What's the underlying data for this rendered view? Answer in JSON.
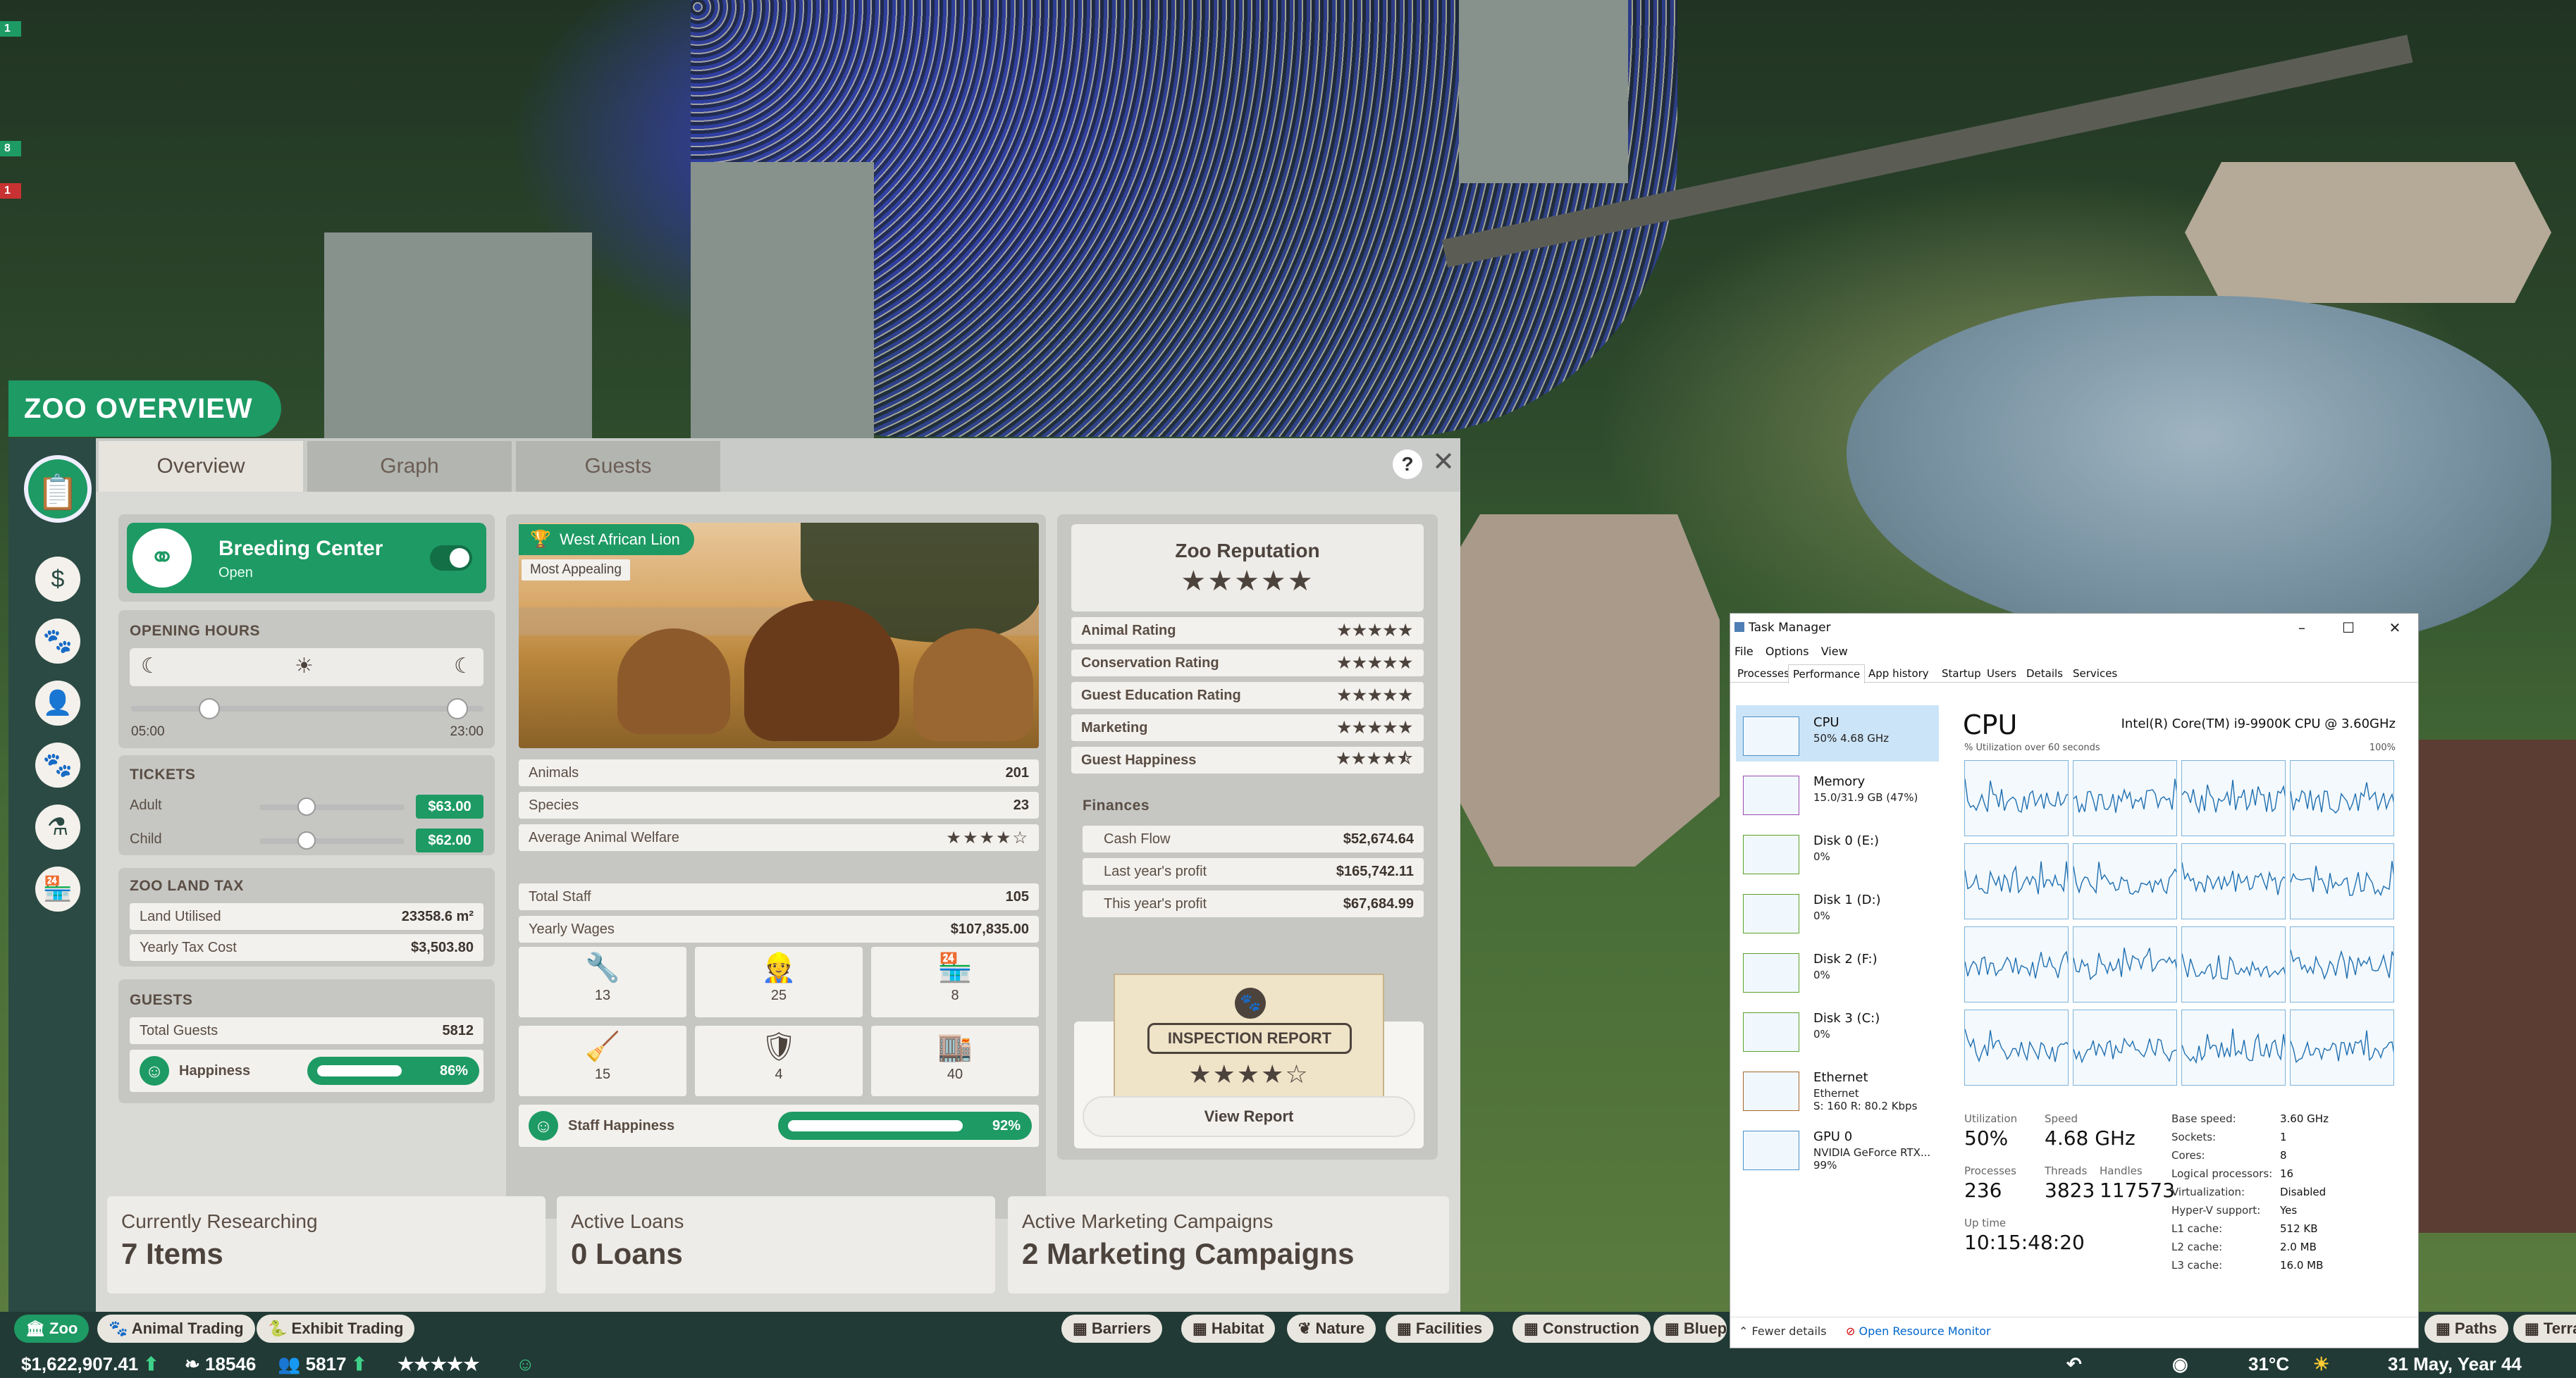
{
  "game": {
    "side_flags": [
      {
        "label": "1",
        "color": "#1e9a64"
      },
      {
        "label": "8",
        "color": "#1e9a64"
      },
      {
        "label": "1",
        "color": "#c83232"
      }
    ],
    "panel_title": "ZOO OVERVIEW",
    "tabs": [
      "Overview",
      "Graph",
      "Guests"
    ],
    "help_label": "?",
    "close_label": "✕",
    "breeding": {
      "title": "Breeding Center",
      "status": "Open"
    },
    "opening_hours": {
      "title": "OPENING HOURS",
      "open": "05:00",
      "close": "23:00"
    },
    "tickets": {
      "title": "TICKETS",
      "adult_label": "Adult",
      "adult_price": "$63.00",
      "child_label": "Child",
      "child_price": "$62.00"
    },
    "land_tax": {
      "title": "ZOO LAND TAX",
      "land_label": "Land Utilised",
      "land_value": "23358.6 m²",
      "tax_label": "Yearly Tax Cost",
      "tax_value": "$3,503.80"
    },
    "guests": {
      "title": "GUESTS",
      "total_label": "Total Guests",
      "total_value": "5812",
      "happiness_label": "Happiness",
      "happiness_pct": "86%",
      "happiness_level": 0.86
    },
    "featured": {
      "badge": "West African Lion",
      "sub": "Most Appealing"
    },
    "animals": [
      {
        "label": "Animals",
        "value": "201"
      },
      {
        "label": "Species",
        "value": "23"
      }
    ],
    "welfare_label": "Average Animal Welfare",
    "welfare_stars": 4,
    "staff": {
      "total_label": "Total Staff",
      "total_value": "105",
      "wages_label": "Yearly Wages",
      "wages_value": "$107,835.00",
      "counts": [
        {
          "icon": "wrench-icon",
          "glyph": "🔧",
          "value": "13"
        },
        {
          "icon": "zookeeper-icon",
          "glyph": "👷",
          "value": "25"
        },
        {
          "icon": "vendor-icon",
          "glyph": "🏪",
          "value": "8"
        },
        {
          "icon": "broom-icon",
          "glyph": "🧹",
          "value": "15"
        },
        {
          "icon": "security-icon",
          "glyph": "🛡",
          "value": "4"
        },
        {
          "icon": "shop-icon",
          "glyph": "🏬",
          "value": "40"
        }
      ],
      "happiness_label": "Staff Happiness",
      "happiness_pct": "92%",
      "happiness_level": 0.92
    },
    "reputation": {
      "title": "Zoo Reputation",
      "stars": 5,
      "ratings": [
        {
          "label": "Animal Rating",
          "stars": 5
        },
        {
          "label": "Conservation Rating",
          "stars": 5
        },
        {
          "label": "Guest Education Rating",
          "stars": 5
        },
        {
          "label": "Marketing",
          "stars": 5
        },
        {
          "label": "Guest Happiness",
          "stars": 4.5
        }
      ]
    },
    "finances": {
      "title": "Finances",
      "rows": [
        {
          "label": "Cash Flow",
          "value": "$52,674.64"
        },
        {
          "label": "Last year's profit",
          "value": "$165,742.11"
        },
        {
          "label": "This year's profit",
          "value": "$67,684.99"
        }
      ]
    },
    "inspection": {
      "title": "INSPECTION REPORT",
      "stars": 4,
      "button": "View Report"
    },
    "bottom_cards": [
      {
        "label": "Currently Researching",
        "value": "7 Items"
      },
      {
        "label": "Active Loans",
        "value": "0 Loans"
      },
      {
        "label": "Active Marketing Campaigns",
        "value": "2 Marketing Campaigns"
      }
    ],
    "bottom_buttons_left": [
      "Zoo",
      "Animal Trading",
      "Exhibit Trading"
    ],
    "bottom_buttons_right": [
      "Barriers",
      "Habitat",
      "Nature",
      "Facilities",
      "Construction",
      "Bluepr",
      "Paths",
      "Terra"
    ],
    "status": {
      "money": "$1,622,907.41",
      "conservation": "18546",
      "guests": "5817",
      "rating_stars": 5,
      "temperature": "31°C",
      "date": "31 May, Year 44"
    },
    "colors": {
      "accent": "#1e9a64",
      "rail": "#2b4a43",
      "panel": "#d9d9d6"
    }
  },
  "taskmanager": {
    "title": "Task Manager",
    "window_buttons": [
      "–",
      "☐",
      "✕"
    ],
    "menu": [
      "File",
      "Options",
      "View"
    ],
    "tabs": [
      "Processes",
      "Performance",
      "App history",
      "Startup",
      "Users",
      "Details",
      "Services"
    ],
    "active_tab": "Performance",
    "sidebar": [
      {
        "name": "CPU",
        "sub1": "50% 4.68 GHz",
        "sub2": ""
      },
      {
        "name": "Memory",
        "sub1": "15.0/31.9 GB (47%)",
        "sub2": ""
      },
      {
        "name": "Disk 0 (E:)",
        "sub1": "0%",
        "sub2": ""
      },
      {
        "name": "Disk 1 (D:)",
        "sub1": "0%",
        "sub2": ""
      },
      {
        "name": "Disk 2 (F:)",
        "sub1": "0%",
        "sub2": ""
      },
      {
        "name": "Disk 3 (C:)",
        "sub1": "0%",
        "sub2": ""
      },
      {
        "name": "Ethernet",
        "sub1": "Ethernet",
        "sub2": "S: 160  R: 80.2 Kbps"
      },
      {
        "name": "GPU 0",
        "sub1": "NVIDIA GeForce RTX...",
        "sub2": "99%"
      }
    ],
    "cpu_title": "CPU",
    "cpu_model": "Intel(R) Core(TM) i9-9900K CPU @ 3.60GHz",
    "util_label": "% Utilization over 60 seconds",
    "util_max": "100%",
    "stats": {
      "utilization_label": "Utilization",
      "utilization": "50%",
      "speed_label": "Speed",
      "speed": "4.68 GHz",
      "processes_label": "Processes",
      "processes": "236",
      "threads_label": "Threads",
      "threads": "3823",
      "handles_label": "Handles",
      "handles": "117573",
      "uptime_label": "Up time",
      "uptime": "10:15:48:20"
    },
    "specs": [
      {
        "label": "Base speed:",
        "value": "3.60 GHz"
      },
      {
        "label": "Sockets:",
        "value": "1"
      },
      {
        "label": "Cores:",
        "value": "8"
      },
      {
        "label": "Logical processors:",
        "value": "16"
      },
      {
        "label": "Virtualization:",
        "value": "Disabled"
      },
      {
        "label": "Hyper-V support:",
        "value": "Yes"
      },
      {
        "label": "L1 cache:",
        "value": "512 KB"
      },
      {
        "label": "L2 cache:",
        "value": "2.0 MB"
      },
      {
        "label": "L3 cache:",
        "value": "16.0 MB"
      }
    ],
    "footer_fewer": "Fewer details",
    "footer_monitor": "Open Resource Monitor"
  }
}
